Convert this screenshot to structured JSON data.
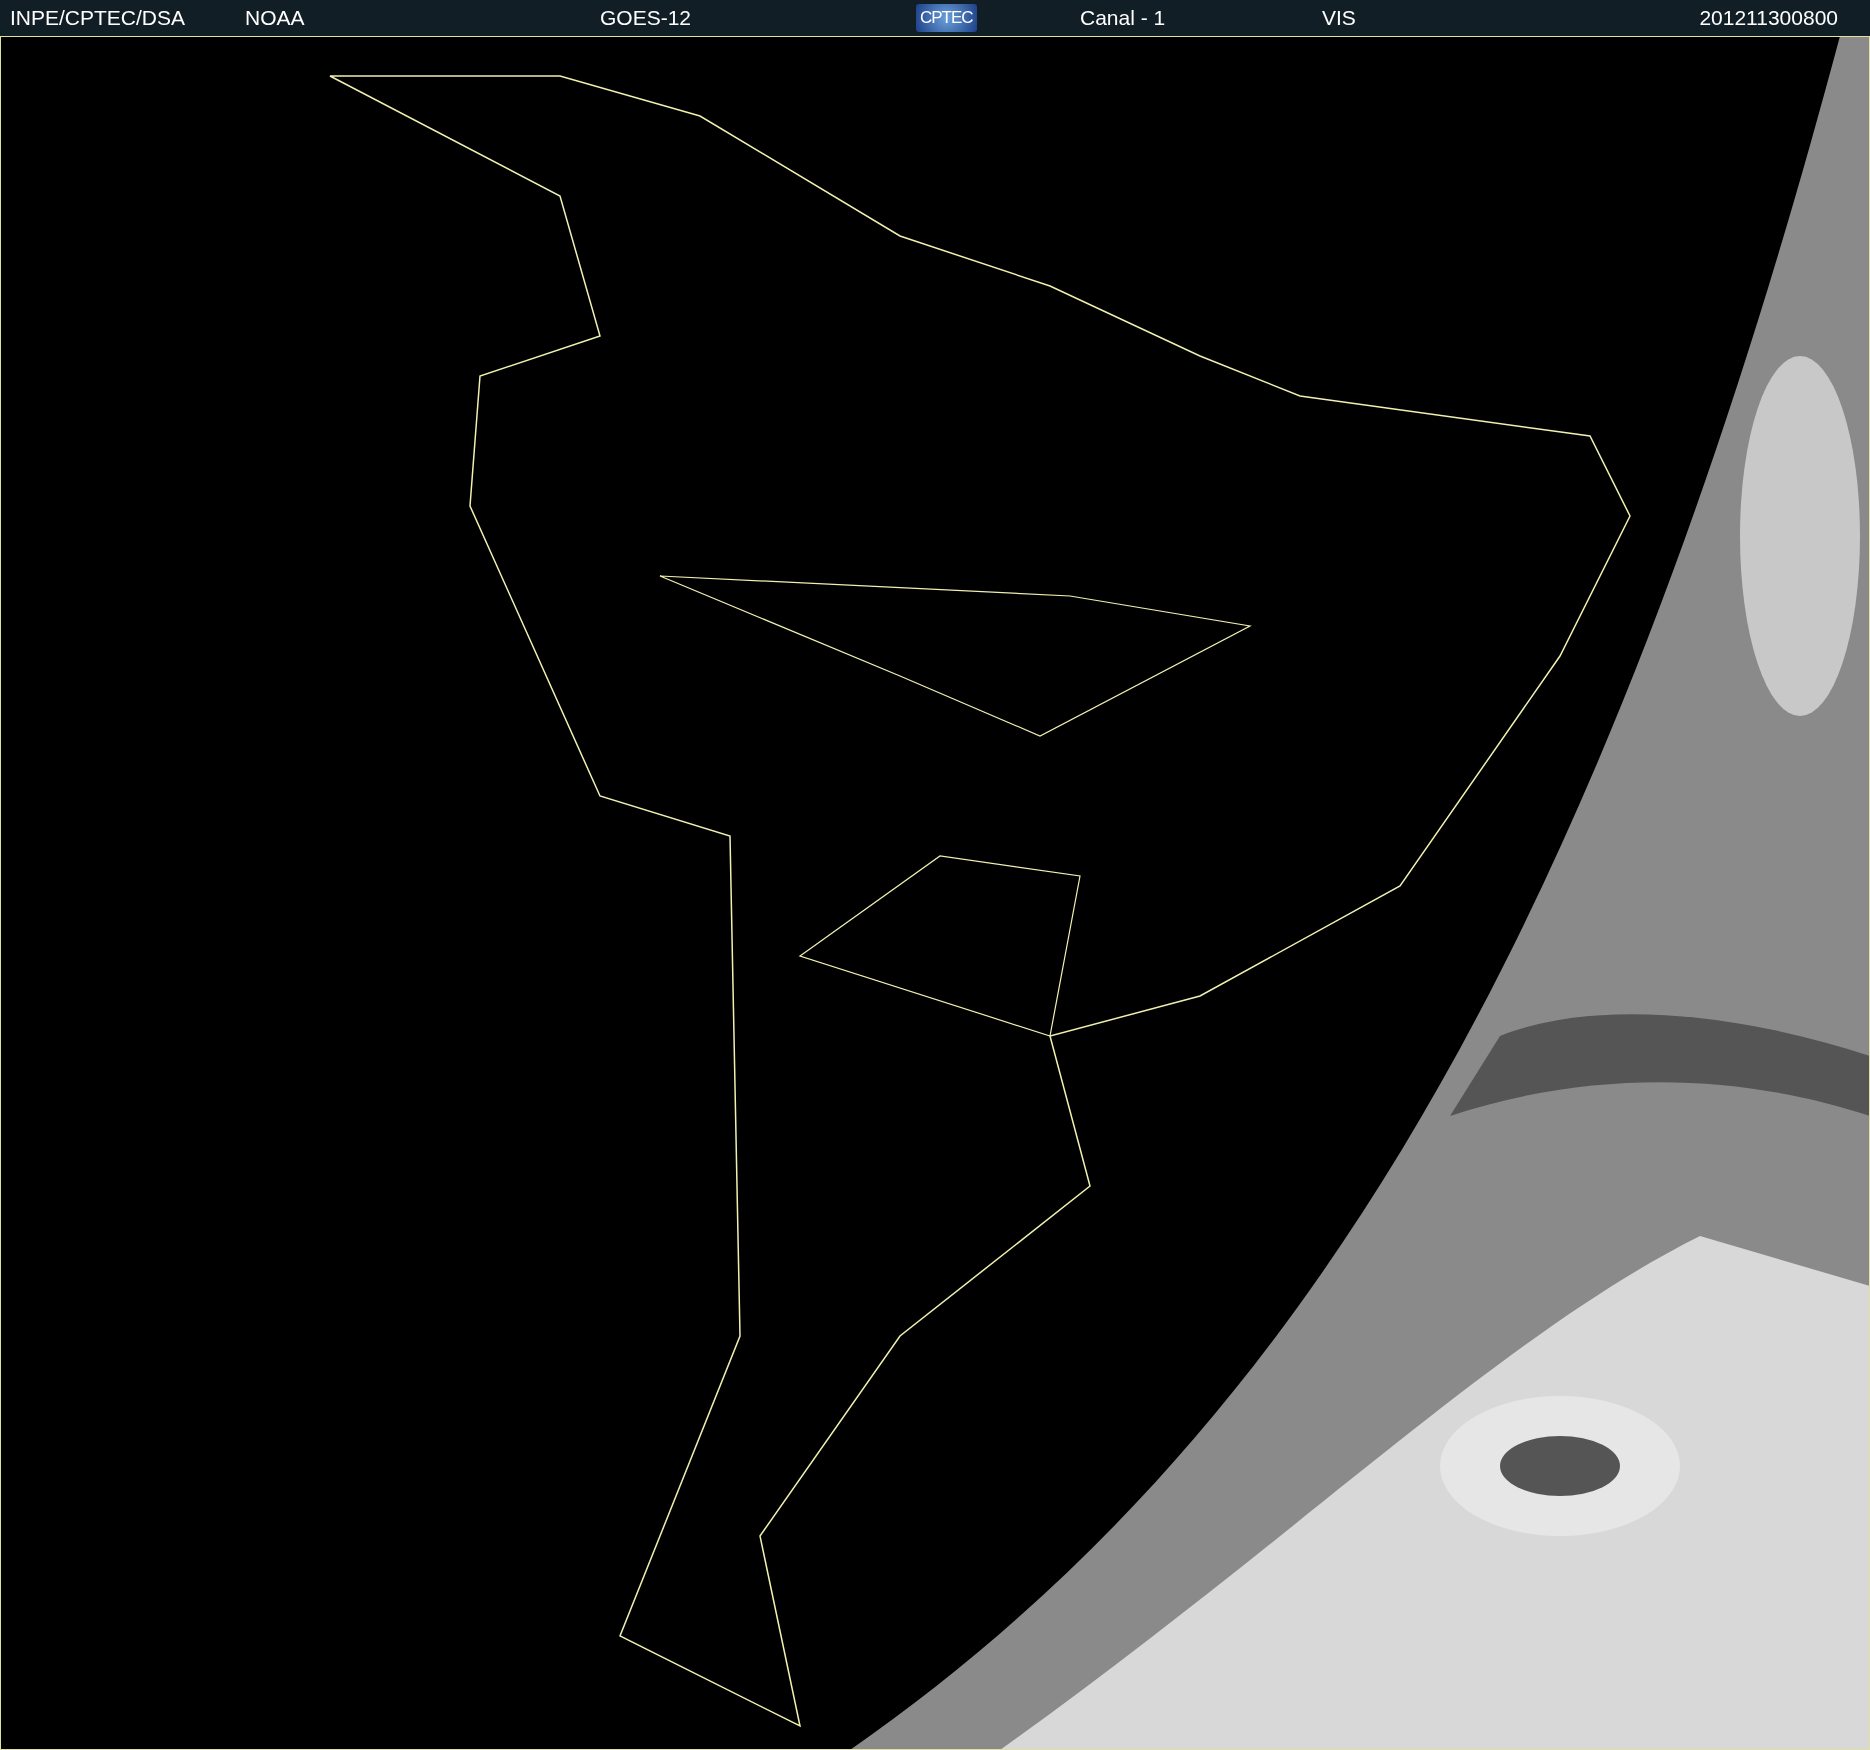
{
  "header": {
    "source": "INPE/CPTEC/DSA",
    "agency": "NOAA",
    "satellite": "GOES-12",
    "logo": "CPTEC",
    "channel": "Canal - 1",
    "band": "VIS",
    "timestamp": "201211300800"
  }
}
